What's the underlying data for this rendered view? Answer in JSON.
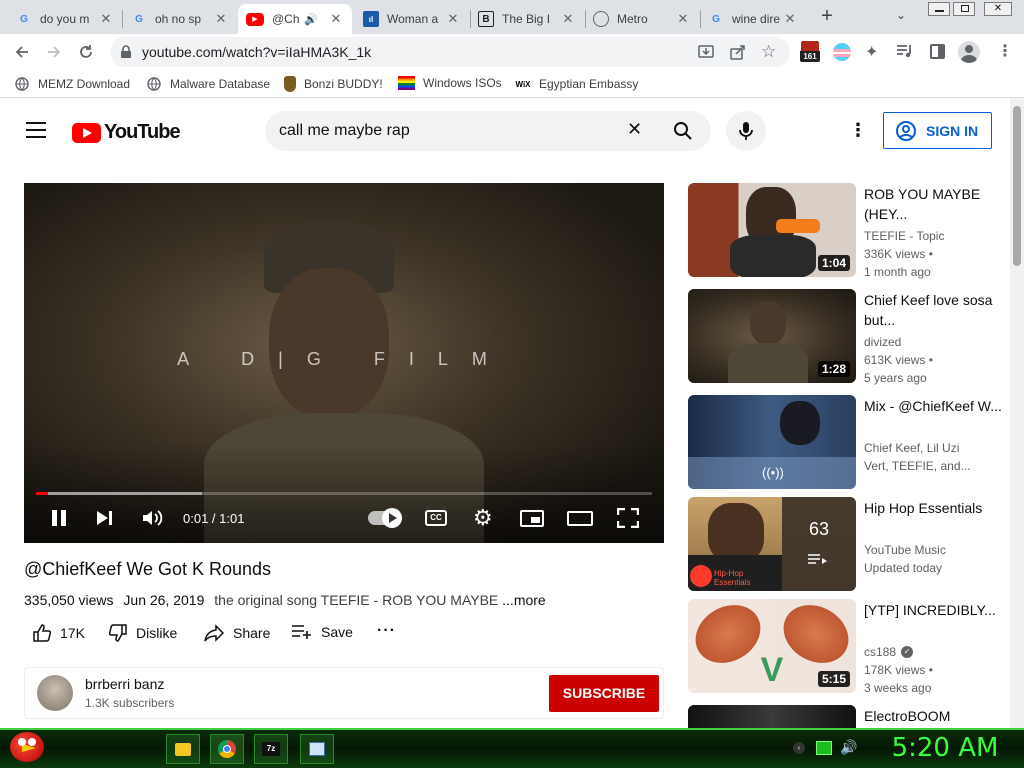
{
  "browser": {
    "tabs": [
      {
        "title": "do you m",
        "favicon": "google"
      },
      {
        "title": "oh no sp",
        "favicon": "google"
      },
      {
        "title": "@Ch",
        "favicon": "youtube",
        "active": true
      },
      {
        "title": "Woman a",
        "favicon": "news"
      },
      {
        "title": "The Big I",
        "favicon": "b"
      },
      {
        "title": "Metro",
        "favicon": "globe"
      },
      {
        "title": "wine dire",
        "favicon": "google"
      }
    ],
    "url": "youtube.com/watch?v=iIaHMA3K_1k",
    "extension_badge": "161",
    "bookmarks": [
      {
        "label": "MEMZ Download",
        "icon": "globe"
      },
      {
        "label": "Malware Database",
        "icon": "globe"
      },
      {
        "label": "Bonzi BUDDY!",
        "icon": "bonzi"
      },
      {
        "label": "Windows ISOs",
        "icon": "windows"
      },
      {
        "label": "Egyptian Embassy",
        "icon": "wix"
      }
    ]
  },
  "youtube": {
    "logo_text": "YouTube",
    "search_value": "call me maybe rap",
    "sign_in": "SIGN IN",
    "video": {
      "overlay_text": "A D|G FILM",
      "time": "0:01 / 1:01",
      "progress": 0.02,
      "buffered": 0.27,
      "title": "@ChiefKeef We Got K Rounds",
      "views": "335,050 views",
      "date": "Jun 26, 2019",
      "desc": "the original song TEEFIE - ROB YOU MAYBE",
      "more": "...more",
      "likes": "17K",
      "dislike": "Dislike",
      "share": "Share",
      "save": "Save"
    },
    "channel": {
      "name": "brrberri banz",
      "subs": "1.3K subscribers",
      "subscribe": "SUBSCRIBE"
    },
    "recs": [
      {
        "title": "ROB YOU MAYBE (HEY...",
        "l1": "TEEFIE - Topic",
        "l2": "336K views •",
        "l3": "1 month ago",
        "duration": "1:04"
      },
      {
        "title": "Chief Keef love sosa but...",
        "l1": "divized",
        "l2": "613K views •",
        "l3": "5 years ago",
        "duration": "1:28"
      },
      {
        "title": "Mix - @ChiefKeef W...",
        "l1": "Chief Keef, Lil Uzi",
        "l2": "Vert, TEEFIE, and...",
        "l3": "",
        "duration": ""
      },
      {
        "title": "Hip Hop Essentials",
        "l1": "YouTube Music",
        "l2": "Updated today",
        "l3": "",
        "duration": "",
        "playlist_count": "63",
        "thumb_text": "Hip-Hop Essentials"
      },
      {
        "title": "[YTP] INCREDIBLY...",
        "l1": "cs188",
        "l2": "178K views •",
        "l3": "3 weeks ago",
        "duration": "5:15"
      },
      {
        "title": "ElectroBOOM",
        "l1": "",
        "l2": "",
        "l3": "",
        "duration": ""
      }
    ]
  },
  "taskbar": {
    "clock": "5:20 AM"
  },
  "colors": {
    "yt_red": "#ff0000",
    "sign_in_blue": "#065fd4",
    "subscribe_red": "#cc0000",
    "taskbar_green": "#3fd13f"
  }
}
